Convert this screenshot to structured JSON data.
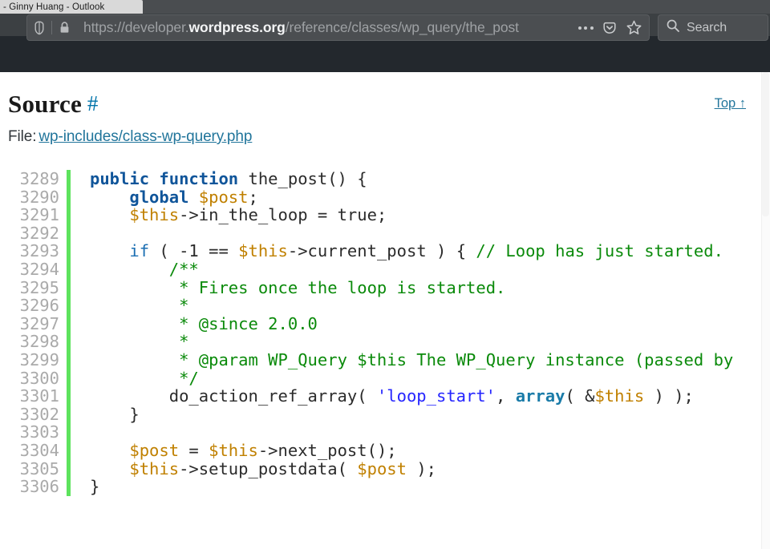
{
  "browser": {
    "tab": {
      "title": "- Ginny Huang - Outlook"
    },
    "urlbar": {
      "url_prefix": "https://developer.",
      "url_host": "wordpress.org",
      "url_path": "/reference/classes/wp_query/the_post",
      "shield_icon": "shield-icon",
      "lock_icon": "padlock-icon",
      "page_actions_icon": "ellipsis-icon",
      "pocket_icon": "pocket-icon",
      "bookmark_icon": "star-icon"
    },
    "search": {
      "placeholder": "Search",
      "icon": "search-icon"
    }
  },
  "page": {
    "heading": "Source",
    "heading_anchor": "#",
    "top_link": "Top ↑",
    "file_label": "File:",
    "file_link": "wp-includes/class-wp-query.php"
  },
  "code": {
    "first_line_number": 3289,
    "line_numbers": [
      "3289",
      "3290",
      "3291",
      "3292",
      "3293",
      "3294",
      "3295",
      "3296",
      "3297",
      "3298",
      "3299",
      "3300",
      "3301",
      "3302",
      "3303",
      "3304",
      "3305",
      "3306"
    ],
    "lines": [
      "<span class=\"k\">public function</span> the_post() {",
      "    <span class=\"k\">global</span> <span class=\"v\">$post</span>;",
      "    <span class=\"v\">$this</span>-&gt;in_the_loop = true;",
      "",
      "    <span class=\"kb\">if</span> ( -1 == <span class=\"v\">$this</span>-&gt;current_post ) { <span class=\"c\">// Loop has just started.</span>",
      "        <span class=\"c\">/**</span>",
      "         <span class=\"c\">* Fires once the loop is started.</span>",
      "         <span class=\"c\">*</span>",
      "         <span class=\"c\">* @since 2.0.0</span>",
      "         <span class=\"c\">*</span>",
      "         <span class=\"c\">* @param WP_Query $this The WP_Query instance (passed by</span>",
      "         <span class=\"c\">*/</span>",
      "        do_action_ref_array( <span class=\"s\">'loop_start'</span>, <span class=\"f\">array</span>( &amp;<span class=\"v\">$this</span> ) );",
      "    }",
      "",
      "    <span class=\"v\">$post</span> = <span class=\"v\">$this</span>-&gt;next_post();",
      "    <span class=\"v\">$this</span>-&gt;setup_postdata( <span class=\"v\">$post</span> );",
      "}"
    ],
    "plain_lines": [
      "public function the_post() {",
      "    global $post;",
      "    $this->in_the_loop = true;",
      "",
      "    if ( -1 == $this->current_post ) { // Loop has just started.",
      "        /**",
      "         * Fires once the loop is started.",
      "         *",
      "         * @since 2.0.0",
      "         *",
      "         * @param WP_Query $this The WP_Query instance (passed by",
      "         */",
      "        do_action_ref_array( 'loop_start', array( &$this ) );",
      "    }",
      "",
      "    $post = $this->next_post();",
      "    $this->setup_postdata( $post );",
      "}"
    ]
  },
  "colors": {
    "chrome_bg": "#3c4043",
    "header_band": "#23282d",
    "link_blue": "#21759b",
    "gutter_accent_green": "#5de35d",
    "comment_green": "#0a8a0a",
    "keyword_blue": "#10559a",
    "variable_orange": "#c08000",
    "string_blue": "#2525ff"
  }
}
